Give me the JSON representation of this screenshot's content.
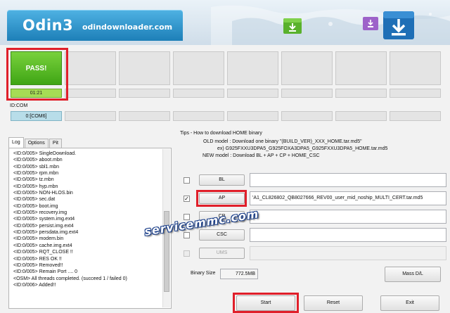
{
  "banner": {
    "logo": "Odin3",
    "site": "odindownloader.com"
  },
  "ports": {
    "status_text": "PASS!",
    "timer_text": "01:21",
    "idcom_label": "ID:COM",
    "com_text": "0:[COM6]"
  },
  "tabs": [
    "Log",
    "Options",
    "Pit"
  ],
  "log": [
    "<ID:0/005> SingleDownload.",
    "<ID:0/005> aboot.mbn",
    "<ID:0/005> sbl1.mbn",
    "<ID:0/005> rpm.mbn",
    "<ID:0/005> tz.mbn",
    "<ID:0/005> hyp.mbn",
    "<ID:0/005> NON-HLOS.bin",
    "<ID:0/005> sec.dat",
    "<ID:0/005> boot.img",
    "<ID:0/005> recovery.img",
    "<ID:0/005> system.img.ext4",
    "<ID:0/005> persist.img.ext4",
    "<ID:0/005> persdata.img.ext4",
    "<ID:0/005> modem.bin",
    "<ID:0/005> cache.img.ext4",
    "<ID:0/005> RQT_CLOSE !!",
    "<ID:0/005> RES OK !!",
    "<ID:0/005> Removed!!",
    "<ID:0/005> Remain Port ....  0",
    "<OSM> All threads completed. (succeed 1 / failed 0)",
    "<ID:0/006> Added!!"
  ],
  "tips": {
    "title": "Tips - How to download HOME binary",
    "line1": "OLD model  : Download one binary    \"(BUILD_VER)_XXX_HOME.tar.md5\"",
    "line2": "ex) G925FXXU3DPA5_G925FOXA3DPA5_G925FXXU3DPA5_HOME.tar.md5",
    "line3": "NEW model : Download BL + AP + CP + HOME_CSC"
  },
  "files": [
    {
      "label": "BL",
      "checked": "",
      "path": ""
    },
    {
      "label": "AP",
      "checked": "✓",
      "path": "'A1_CL826802_QB8027666_REV00_user_mid_noship_MULTI_CERT.tar.md5"
    },
    {
      "label": "CP",
      "checked": "",
      "path": ""
    },
    {
      "label": "CSC",
      "checked": "",
      "path": ""
    },
    {
      "label": "UMS",
      "checked": "",
      "path": ""
    }
  ],
  "watermark": "servicemmc.com",
  "binary": {
    "label": "Binary Size",
    "value": "772.5MB"
  },
  "buttons": {
    "mass": "Mass D/L",
    "start": "Start",
    "reset": "Reset",
    "exit": "Exit"
  },
  "colors": {
    "pass": "#4fb820",
    "highlight": "#e01f2a",
    "banner_blue": "#2a8fc9",
    "com_active": "#b8dde9"
  }
}
